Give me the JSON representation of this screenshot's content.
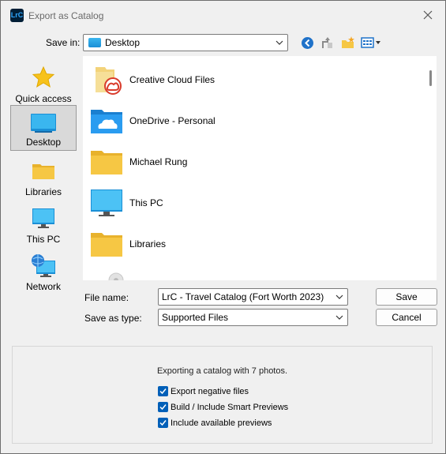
{
  "window": {
    "title": "Export as Catalog",
    "app_icon_text": "LrC"
  },
  "save_in": {
    "label": "Save in:",
    "value": "Desktop"
  },
  "toolbar": {
    "icons": [
      "back-icon",
      "up-folder-icon",
      "new-folder-icon",
      "view-menu-icon"
    ]
  },
  "places": [
    {
      "label": "Quick access",
      "icon": "star-icon"
    },
    {
      "label": "Desktop",
      "icon": "desktop-icon",
      "selected": true
    },
    {
      "label": "Libraries",
      "icon": "libraries-icon"
    },
    {
      "label": "This PC",
      "icon": "this-pc-icon"
    },
    {
      "label": "Network",
      "icon": "network-icon"
    }
  ],
  "files": [
    {
      "name": "Creative Cloud Files",
      "icon": "creative-cloud-folder-icon"
    },
    {
      "name": "OneDrive - Personal",
      "icon": "onedrive-folder-icon"
    },
    {
      "name": "Michael Rung",
      "icon": "user-folder-icon"
    },
    {
      "name": "This PC",
      "icon": "this-pc-icon"
    },
    {
      "name": "Libraries",
      "icon": "libraries-folder-icon"
    }
  ],
  "file_name": {
    "label": "File name:",
    "value": "LrC - Travel Catalog (Fort Worth 2023)"
  },
  "save_as_type": {
    "label": "Save as type:",
    "value": "Supported Files"
  },
  "buttons": {
    "save": "Save",
    "cancel": "Cancel"
  },
  "options": {
    "message": "Exporting a catalog with 7 photos.",
    "checkboxes": [
      {
        "label": "Export negative files",
        "checked": true
      },
      {
        "label": "Build / Include Smart Previews",
        "checked": true
      },
      {
        "label": "Include available previews",
        "checked": true
      }
    ]
  },
  "colors": {
    "accent": "#005fb8",
    "folder": "#f6c744"
  }
}
